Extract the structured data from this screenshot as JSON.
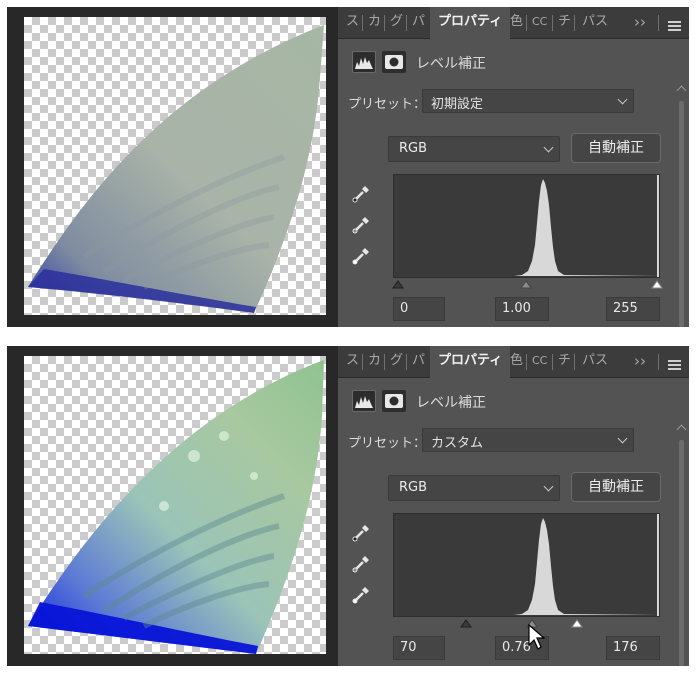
{
  "tabs": [
    "ス",
    "カ",
    "グ",
    "パ",
    "プロパティ",
    "色",
    "CC",
    "チ",
    "パス"
  ],
  "tab_overflow": "››",
  "panel_title": "レベル補正",
  "preset_label": "プリセット：",
  "channel_value": "RGB",
  "auto_button_label": "自動補正",
  "icons": {
    "histogram": "levels-histogram-icon",
    "mask": "layer-mask-icon",
    "black_eyedropper": "black-point-eyedropper-icon",
    "gray_eyedropper": "gray-point-eyedropper-icon",
    "white_eyedropper": "white-point-eyedropper-icon",
    "menu": "hamburger-menu-icon",
    "cursor": "mouse-pointer-icon"
  },
  "colors": {
    "panel_bg": "#535353",
    "tabbar_bg": "#3c3c3c",
    "histogram_fill": "#d8d8d8",
    "app_bg": "#282828"
  },
  "screens": [
    {
      "preset_value": "初期設定",
      "input_black": "0",
      "input_gamma": "1.00",
      "input_white": "255",
      "handles": {
        "black": 0,
        "gamma": 1.0,
        "white": 255
      },
      "cursor_visible": false
    },
    {
      "preset_value": "カスタム",
      "input_black": "70",
      "input_gamma": "0.76",
      "input_white": "176",
      "handles": {
        "black": 70,
        "gamma": 0.76,
        "white": 176
      },
      "cursor_visible": true
    }
  ]
}
